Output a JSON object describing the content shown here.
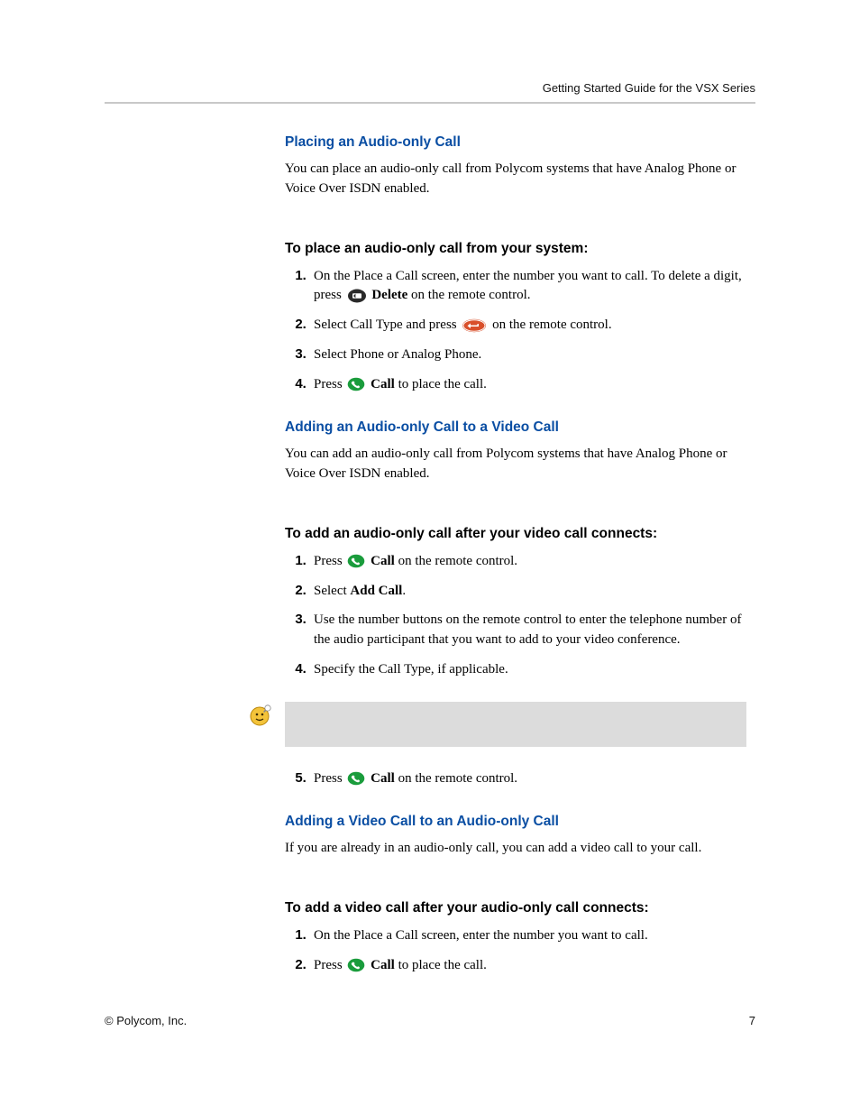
{
  "header": "Getting Started Guide for the VSX Series",
  "sections": {
    "s1": {
      "heading": "Placing an Audio-only Call",
      "intro": "You can place an audio-only call from Polycom systems that have Analog Phone or Voice Over ISDN enabled.",
      "sub": "To place an audio-only call from your system:",
      "li1a": "On the Place a Call screen, enter the number you want to call. To delete a digit, press ",
      "li1_delete": "Delete",
      "li1b": " on the remote control.",
      "li2a": "Select Call Type and press ",
      "li2b": " on the remote control.",
      "li3": "Select Phone or Analog Phone.",
      "li4a": "Press ",
      "li4_call": "Call",
      "li4b": " to place the call."
    },
    "s2": {
      "heading": "Adding an Audio-only Call to a Video Call",
      "intro": "You can add an audio-only call from Polycom systems that have Analog Phone or Voice Over ISDN enabled.",
      "sub": "To add an audio-only call after your video call connects:",
      "li1a": "Press ",
      "li1_call": "Call",
      "li1b": " on the remote control.",
      "li2a": "Select ",
      "li2_add": "Add Call",
      "li2b": ".",
      "li3": "Use the number buttons on the remote control to enter the telephone number of the audio participant that you want to add to your video conference.",
      "li4": "Specify the Call Type, if applicable.",
      "li5a": "Press ",
      "li5_call": "Call",
      "li5b": " on the remote control."
    },
    "s3": {
      "heading": "Adding a Video Call to an Audio-only Call",
      "intro": "If you are already in an audio-only call, you can add a video call to your call.",
      "sub": "To add a video call after your audio-only call connects:",
      "li1": "On the Place a Call screen, enter the number you want to call.",
      "li2a": "Press ",
      "li2_call": "Call",
      "li2b": " to place the call."
    }
  },
  "footer": {
    "left": "© Polycom, Inc.",
    "right": "7"
  }
}
